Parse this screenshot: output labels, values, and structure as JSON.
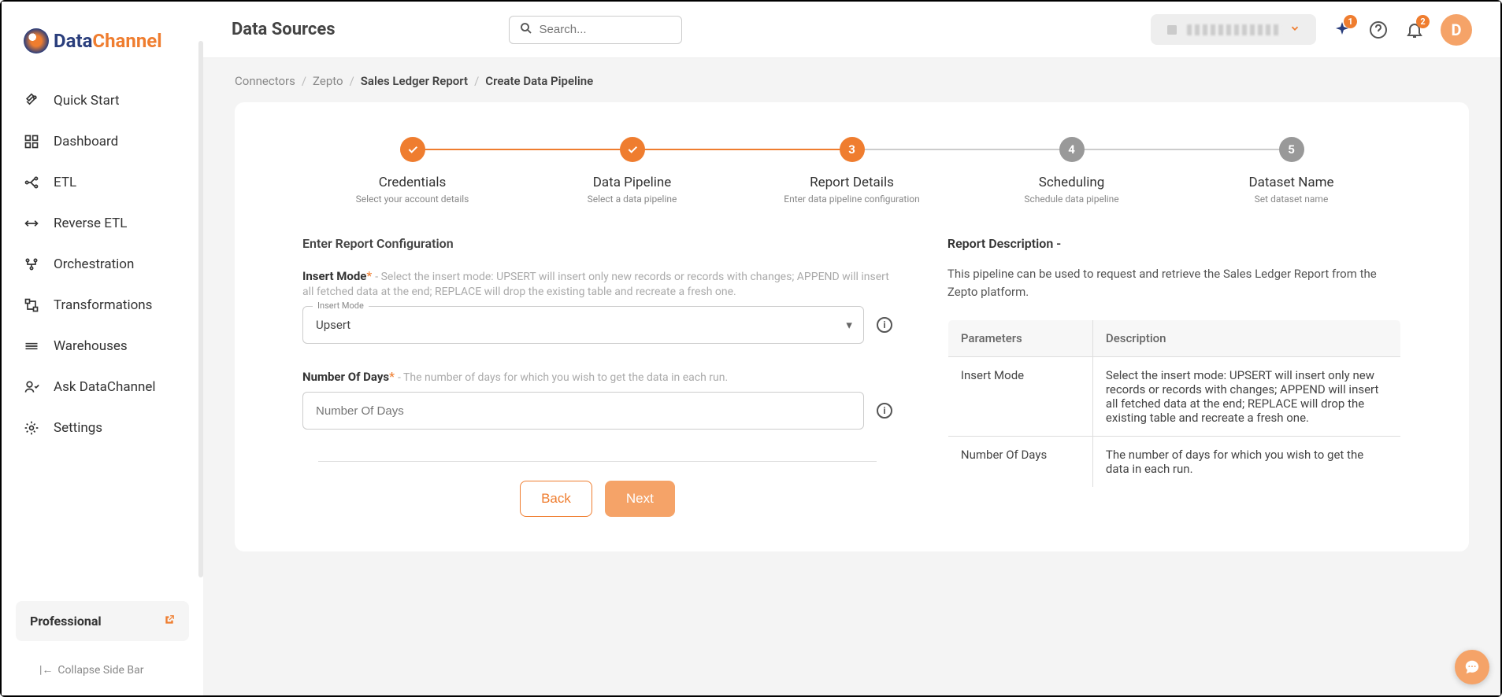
{
  "brand": {
    "part1": "Data",
    "part2": "Channel"
  },
  "sidebar": {
    "items": [
      {
        "icon": "rocket",
        "label": "Quick Start"
      },
      {
        "icon": "grid",
        "label": "Dashboard"
      },
      {
        "icon": "flow",
        "label": "ETL"
      },
      {
        "icon": "reverse",
        "label": "Reverse ETL"
      },
      {
        "icon": "orch",
        "label": "Orchestration"
      },
      {
        "icon": "transform",
        "label": "Transformations"
      },
      {
        "icon": "wh",
        "label": "Warehouses"
      },
      {
        "icon": "ask",
        "label": "Ask DataChannel"
      },
      {
        "icon": "gear",
        "label": "Settings"
      }
    ],
    "plan": "Professional",
    "collapse": "Collapse Side Bar"
  },
  "header": {
    "title": "Data Sources",
    "search_placeholder": "Search...",
    "sparkle_badge": "1",
    "bell_badge": "2",
    "avatar": "D"
  },
  "breadcrumb": {
    "items": [
      "Connectors",
      "Zepto",
      "Sales Ledger Report",
      "Create Data Pipeline"
    ]
  },
  "stepper": [
    {
      "state": "done",
      "title": "Credentials",
      "sub": "Select your account details"
    },
    {
      "state": "done",
      "title": "Data Pipeline",
      "sub": "Select a data pipeline"
    },
    {
      "state": "active",
      "num": "3",
      "title": "Report Details",
      "sub": "Enter data pipeline configuration"
    },
    {
      "state": "pending",
      "num": "4",
      "title": "Scheduling",
      "sub": "Schedule data pipeline"
    },
    {
      "state": "pending",
      "num": "5",
      "title": "Dataset Name",
      "sub": "Set dataset name"
    }
  ],
  "form": {
    "section_title": "Enter Report Configuration",
    "insert_mode": {
      "label": "Insert Mode",
      "desc": "- Select the insert mode: UPSERT will insert only new records or records with changes; APPEND will insert all fetched data at the end; REPLACE will drop the existing table and recreate a fresh one.",
      "float": "Insert Mode",
      "value": "Upsert"
    },
    "num_days": {
      "label": "Number Of Days",
      "desc": "- The number of days for which you wish to get the data in each run.",
      "placeholder": "Number Of Days"
    },
    "back": "Back",
    "next": "Next"
  },
  "report_desc": {
    "title": "Report Description -",
    "text": "This pipeline can be used to request and retrieve the Sales Ledger Report from the Zepto platform.",
    "th1": "Parameters",
    "th2": "Description",
    "rows": [
      {
        "p": "Insert Mode",
        "d": "Select the insert mode: UPSERT will insert only new records or records with changes; APPEND will insert all fetched data at the end; REPLACE will drop the existing table and recreate a fresh one."
      },
      {
        "p": "Number Of Days",
        "d": "The number of days for which you wish to get the data in each run."
      }
    ]
  }
}
